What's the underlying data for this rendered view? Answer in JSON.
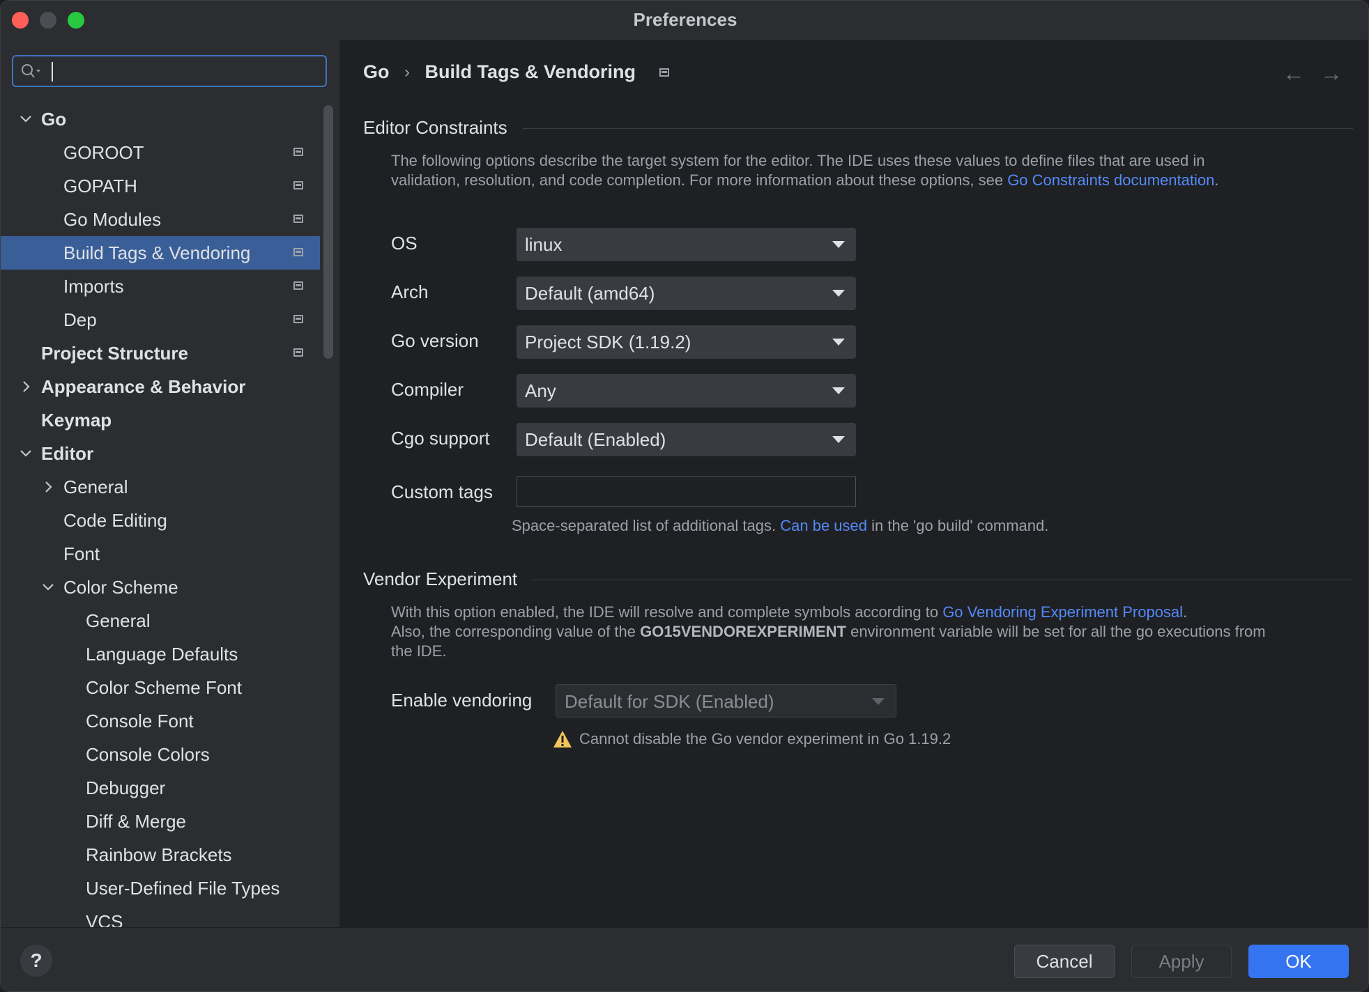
{
  "window": {
    "title": "Preferences",
    "traffic_lights": [
      "#ff5f57",
      "#4a4d52",
      "#28c840"
    ]
  },
  "search": {
    "value": "",
    "placeholder": ""
  },
  "sidebar": {
    "items": [
      {
        "label": "Go",
        "indent": 0,
        "bold": true,
        "expander": "expanded",
        "project": false,
        "selected": false
      },
      {
        "label": "GOROOT",
        "indent": 1,
        "bold": false,
        "expander": "none",
        "project": true,
        "selected": false
      },
      {
        "label": "GOPATH",
        "indent": 1,
        "bold": false,
        "expander": "none",
        "project": true,
        "selected": false
      },
      {
        "label": "Go Modules",
        "indent": 1,
        "bold": false,
        "expander": "none",
        "project": true,
        "selected": false
      },
      {
        "label": "Build Tags & Vendoring",
        "indent": 1,
        "bold": false,
        "expander": "none",
        "project": true,
        "selected": true
      },
      {
        "label": "Imports",
        "indent": 1,
        "bold": false,
        "expander": "none",
        "project": true,
        "selected": false
      },
      {
        "label": "Dep",
        "indent": 1,
        "bold": false,
        "expander": "none",
        "project": true,
        "selected": false
      },
      {
        "label": "Project Structure",
        "indent": 0,
        "bold": true,
        "expander": "none",
        "project": true,
        "selected": false
      },
      {
        "label": "Appearance & Behavior",
        "indent": 0,
        "bold": true,
        "expander": "collapsed",
        "project": false,
        "selected": false
      },
      {
        "label": "Keymap",
        "indent": 0,
        "bold": true,
        "expander": "none",
        "project": false,
        "selected": false
      },
      {
        "label": "Editor",
        "indent": 0,
        "bold": true,
        "expander": "expanded",
        "project": false,
        "selected": false
      },
      {
        "label": "General",
        "indent": 1,
        "bold": false,
        "expander": "collapsed",
        "project": false,
        "selected": false
      },
      {
        "label": "Code Editing",
        "indent": 1,
        "bold": false,
        "expander": "none",
        "project": false,
        "selected": false
      },
      {
        "label": "Font",
        "indent": 1,
        "bold": false,
        "expander": "none",
        "project": false,
        "selected": false
      },
      {
        "label": "Color Scheme",
        "indent": 1,
        "bold": false,
        "expander": "expanded",
        "project": false,
        "selected": false
      },
      {
        "label": "General",
        "indent": 2,
        "bold": false,
        "expander": "none",
        "project": false,
        "selected": false
      },
      {
        "label": "Language Defaults",
        "indent": 2,
        "bold": false,
        "expander": "none",
        "project": false,
        "selected": false
      },
      {
        "label": "Color Scheme Font",
        "indent": 2,
        "bold": false,
        "expander": "none",
        "project": false,
        "selected": false
      },
      {
        "label": "Console Font",
        "indent": 2,
        "bold": false,
        "expander": "none",
        "project": false,
        "selected": false
      },
      {
        "label": "Console Colors",
        "indent": 2,
        "bold": false,
        "expander": "none",
        "project": false,
        "selected": false
      },
      {
        "label": "Debugger",
        "indent": 2,
        "bold": false,
        "expander": "none",
        "project": false,
        "selected": false
      },
      {
        "label": "Diff & Merge",
        "indent": 2,
        "bold": false,
        "expander": "none",
        "project": false,
        "selected": false
      },
      {
        "label": "Rainbow Brackets",
        "indent": 2,
        "bold": false,
        "expander": "none",
        "project": false,
        "selected": false
      },
      {
        "label": "User-Defined File Types",
        "indent": 2,
        "bold": false,
        "expander": "none",
        "project": false,
        "selected": false
      },
      {
        "label": "VCS",
        "indent": 2,
        "bold": false,
        "expander": "none",
        "project": false,
        "selected": false
      }
    ]
  },
  "breadcrumb": {
    "root": "Go",
    "current": "Build Tags & Vendoring"
  },
  "editor_constraints": {
    "title": "Editor Constraints",
    "desc_line1": "The following options describe the target system for the editor. The IDE uses these values to define files that are used in",
    "desc_line2_prefix": "validation, resolution, and code completion. For more information about these options, see ",
    "desc_link": "Go Constraints documentation",
    "desc_line2_suffix": ".",
    "fields": [
      {
        "label": "OS",
        "value": "linux"
      },
      {
        "label": "Arch",
        "value": "Default (amd64)"
      },
      {
        "label": "Go version",
        "value": "Project SDK (1.19.2)"
      },
      {
        "label": "Compiler",
        "value": "Any"
      },
      {
        "label": "Cgo support",
        "value": "Default (Enabled)"
      }
    ],
    "custom_tags_label": "Custom tags",
    "custom_tags_value": "",
    "hint_prefix": "Space-separated list of additional tags. ",
    "hint_link": "Can be used",
    "hint_suffix": " in the 'go build' command."
  },
  "vendor_experiment": {
    "title": "Vendor Experiment",
    "line1_prefix": "With this option enabled, the IDE will resolve and complete symbols according to ",
    "line1_link": "Go Vendoring Experiment Proposal",
    "line1_suffix": ".",
    "line2_prefix": "Also, the corresponding value of the ",
    "line2_strong": "GO15VENDOREXPERIMENT",
    "line2_suffix": " environment variable will be set for all the go executions from",
    "line3": "the IDE.",
    "enable_label": "Enable vendoring",
    "enable_value": "Default for SDK (Enabled)",
    "warning": "Cannot disable the Go vendor experiment in Go 1.19.2"
  },
  "buttons": {
    "help": "?",
    "cancel": "Cancel",
    "apply": "Apply",
    "ok": "OK"
  },
  "colors": {
    "accent": "#3574f0",
    "selection": "#3a5f98",
    "link": "#548af7",
    "warning": "#f2c55c"
  }
}
